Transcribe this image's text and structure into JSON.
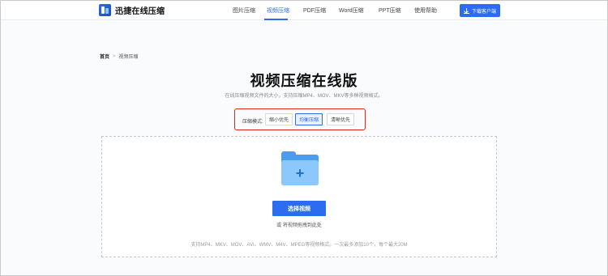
{
  "header": {
    "logo_text": "迅捷在线压缩",
    "nav": [
      {
        "label": "图片压缩",
        "active": false
      },
      {
        "label": "视频压缩",
        "active": true
      },
      {
        "label": "PDF压缩",
        "active": false
      },
      {
        "label": "Word压缩",
        "active": false
      },
      {
        "label": "PPT压缩",
        "active": false
      },
      {
        "label": "使用帮助",
        "active": false
      }
    ],
    "download_label": "下载客户端"
  },
  "breadcrumb": {
    "home": "首页",
    "separator": ">",
    "current": "视频压缩"
  },
  "page": {
    "title": "视频压缩在线版",
    "subtitle": "在线压缩视频文件的大小，支持压缩MP4、MOV、MKV等多种视频格式。"
  },
  "mode": {
    "label": "压缩模式:",
    "options": [
      {
        "label": "缩小优先",
        "active": false
      },
      {
        "label": "均衡压缩",
        "active": true
      },
      {
        "label": "清晰优先",
        "active": false
      }
    ]
  },
  "upload": {
    "button_label": "选择视频",
    "drag_hint": "或 将视频拖拽到此处",
    "support_text": "支持MP4、MKV、MOV、AVI、WMV、M4V、MPEG等视频格式。一次最多添加10个，每个最大20M"
  },
  "colors": {
    "accent": "#2c6cf0",
    "highlight_box": "#e0251b",
    "folder_dark": "#4a9df0",
    "folder_light": "#8cc8fb"
  }
}
